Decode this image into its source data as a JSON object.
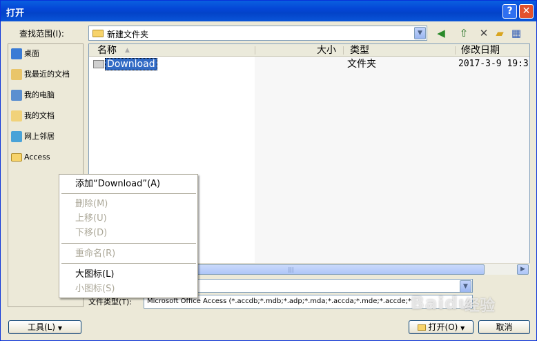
{
  "window": {
    "title": "打开",
    "help_label": "?",
    "close_label": "✕"
  },
  "lookin": {
    "label": "查找范围(I):",
    "value": "新建文件夹"
  },
  "toolbar": {
    "back_icon": "back-icon",
    "up_icon": "up-folder-icon",
    "delete_icon": "delete-icon",
    "newfolder_icon": "new-folder-icon",
    "views_icon": "views-icon"
  },
  "places": [
    {
      "label": "桌面",
      "icon": "desktop-icon"
    },
    {
      "label": "我最近的文档",
      "icon": "recent-docs-icon"
    },
    {
      "label": "我的电脑",
      "icon": "my-computer-icon"
    },
    {
      "label": "我的文档",
      "icon": "my-documents-icon"
    },
    {
      "label": "网上邻居",
      "icon": "network-icon"
    },
    {
      "label": "Access",
      "icon": "folder-icon"
    }
  ],
  "columns": {
    "name": "名称",
    "size": "大小",
    "type": "类型",
    "modified": "修改日期"
  },
  "files": [
    {
      "name": "Download",
      "size": "",
      "type": "文件夹",
      "modified": "2017-3-9 19:3"
    }
  ],
  "filetype": {
    "label": "文件类型(T):",
    "value": "Microsoft Office Access (*.accdb;*.mdb;*.adp;*.mda;*.accda;*.mde;*.accde;*"
  },
  "buttons": {
    "tools": "工具(L)",
    "open": "打开(O)",
    "cancel": "取消"
  },
  "context_menu": {
    "add": "添加“Download”(A)",
    "delete": "删除(M)",
    "move_up": "上移(U)",
    "move_down": "下移(D)",
    "rename": "重命名(R)",
    "large_icons": "大图标(L)",
    "small_icons": "小图标(S)"
  },
  "watermark": {
    "brand": "Baidu",
    "suffix": "经验"
  }
}
